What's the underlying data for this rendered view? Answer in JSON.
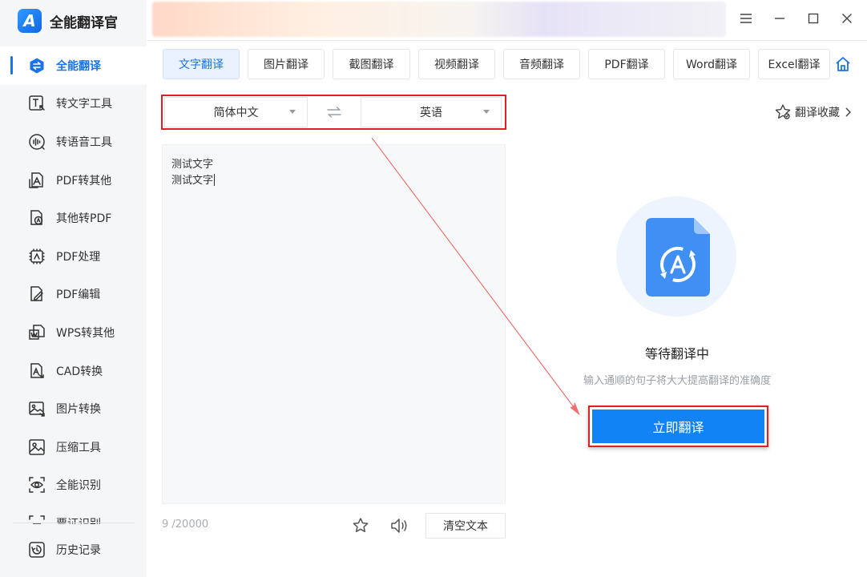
{
  "app": {
    "name": "全能翻译官",
    "logo_letter": "A"
  },
  "sidebar": {
    "items": [
      {
        "label": "全能翻译",
        "icon": "translate-swap-icon",
        "active": true
      },
      {
        "label": "转文字工具",
        "icon": "text-convert-icon"
      },
      {
        "label": "转语音工具",
        "icon": "voice-wave-icon"
      },
      {
        "label": "PDF转其他",
        "icon": "pdf-export-icon"
      },
      {
        "label": "其他转PDF",
        "icon": "pdf-import-icon"
      },
      {
        "label": "PDF处理",
        "icon": "pdf-process-icon"
      },
      {
        "label": "PDF编辑",
        "icon": "pdf-edit-icon"
      },
      {
        "label": "WPS转其他",
        "icon": "wps-convert-icon"
      },
      {
        "label": "CAD转换",
        "icon": "cad-convert-icon"
      },
      {
        "label": "图片转换",
        "icon": "image-convert-icon"
      },
      {
        "label": "压缩工具",
        "icon": "compress-icon"
      },
      {
        "label": "全能识别",
        "icon": "recognize-eye-icon"
      },
      {
        "label": "票证识别",
        "icon": "ticket-scan-icon"
      }
    ],
    "history": {
      "label": "历史记录",
      "icon": "history-icon"
    }
  },
  "window": {
    "controls": [
      "menu-icon",
      "minimize-icon",
      "maximize-icon",
      "close-icon"
    ]
  },
  "tabs": [
    {
      "label": "文字翻译",
      "active": true
    },
    {
      "label": "图片翻译"
    },
    {
      "label": "截图翻译"
    },
    {
      "label": "视频翻译"
    },
    {
      "label": "音频翻译"
    },
    {
      "label": "PDF翻译"
    },
    {
      "label": "Word翻译"
    },
    {
      "label": "Excel翻译"
    }
  ],
  "language": {
    "source": "简体中文",
    "target": "英语"
  },
  "favorites": {
    "label": "翻译收藏"
  },
  "editor": {
    "lines": [
      "测试文字",
      "测试文字"
    ],
    "counter": "9 /20000",
    "clear_label": "清空文本"
  },
  "result": {
    "status": "等待翻译中",
    "hint": "输入通顺的句子将大大提高翻译的准确度",
    "translate_label": "立即翻译"
  },
  "colors": {
    "accent": "#1a73e8",
    "button": "#1183f5",
    "highlight": "#e02020"
  }
}
